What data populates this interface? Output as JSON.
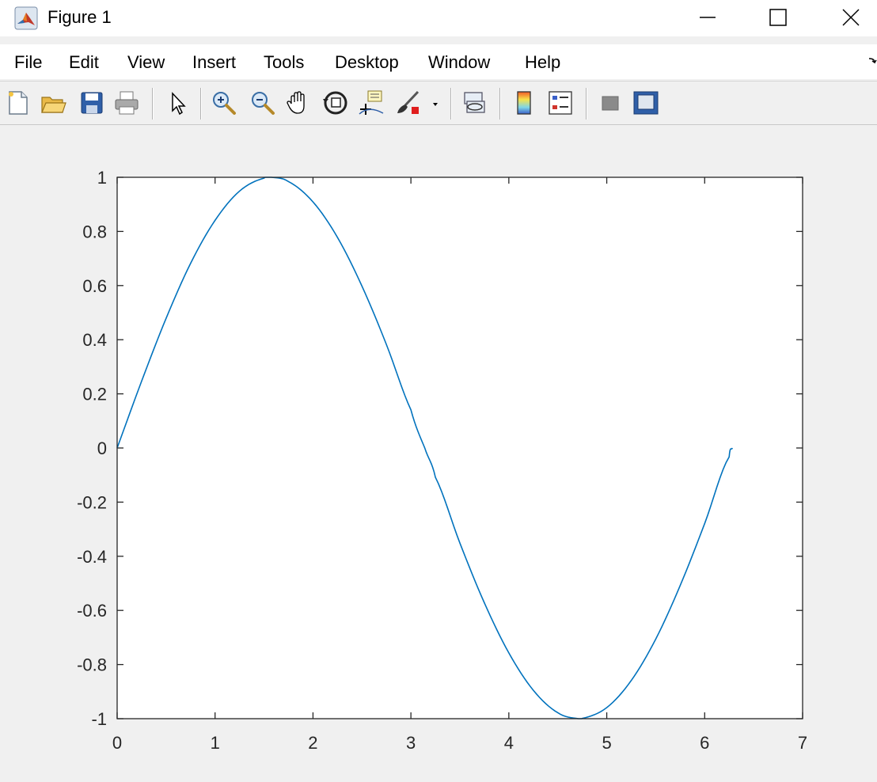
{
  "window": {
    "title": "Figure 1",
    "icon": "matlab-logo-icon",
    "controls": [
      "minimize-icon",
      "maximize-icon",
      "close-icon"
    ]
  },
  "menubar": {
    "items": [
      "File",
      "Edit",
      "View",
      "Insert",
      "Tools",
      "Desktop",
      "Window",
      "Help"
    ],
    "overflow_icon": "menu-overflow-icon"
  },
  "toolbar": {
    "buttons": [
      "new-figure-icon",
      "open-file-icon",
      "save-icon",
      "print-icon",
      "edit-plot-arrow-icon",
      "zoom-in-icon",
      "zoom-out-icon",
      "pan-hand-icon",
      "rotate-3d-icon",
      "data-cursor-icon",
      "brush-icon",
      "brush-dropdown-icon",
      "link-plot-icon",
      "insert-colorbar-icon",
      "insert-legend-icon",
      "hide-plot-tools-icon",
      "show-plot-tools-icon"
    ]
  },
  "chart_data": {
    "type": "line",
    "title": "",
    "xlabel": "",
    "ylabel": "",
    "xlim": [
      0,
      7
    ],
    "ylim": [
      -1,
      1
    ],
    "xticks": [
      "0",
      "1",
      "2",
      "3",
      "4",
      "5",
      "6",
      "7"
    ],
    "yticks": [
      "-1",
      "-0.8",
      "-0.6",
      "-0.4",
      "-0.2",
      "0",
      "0.2",
      "0.4",
      "0.6",
      "0.8",
      "1"
    ],
    "grid": false,
    "series": [
      {
        "color": "#0072bd",
        "x": [
          0,
          0.25,
          0.5,
          0.75,
          1.0,
          1.25,
          1.5,
          1.5708,
          1.75,
          2.0,
          2.25,
          2.5,
          2.75,
          3.0,
          3.1416,
          3.25,
          3.5,
          3.75,
          4.0,
          4.25,
          4.5,
          4.7124,
          4.75,
          5.0,
          5.25,
          5.5,
          5.75,
          6.0,
          6.25,
          6.2832
        ],
        "y": [
          0,
          0.247,
          0.479,
          0.682,
          0.841,
          0.949,
          0.997,
          1.0,
          0.984,
          0.909,
          0.778,
          0.598,
          0.382,
          0.141,
          0,
          -0.108,
          -0.351,
          -0.572,
          -0.757,
          -0.895,
          -0.978,
          -1.0,
          -0.999,
          -0.959,
          -0.859,
          -0.706,
          -0.508,
          -0.279,
          -0.033,
          0
        ]
      }
    ]
  }
}
